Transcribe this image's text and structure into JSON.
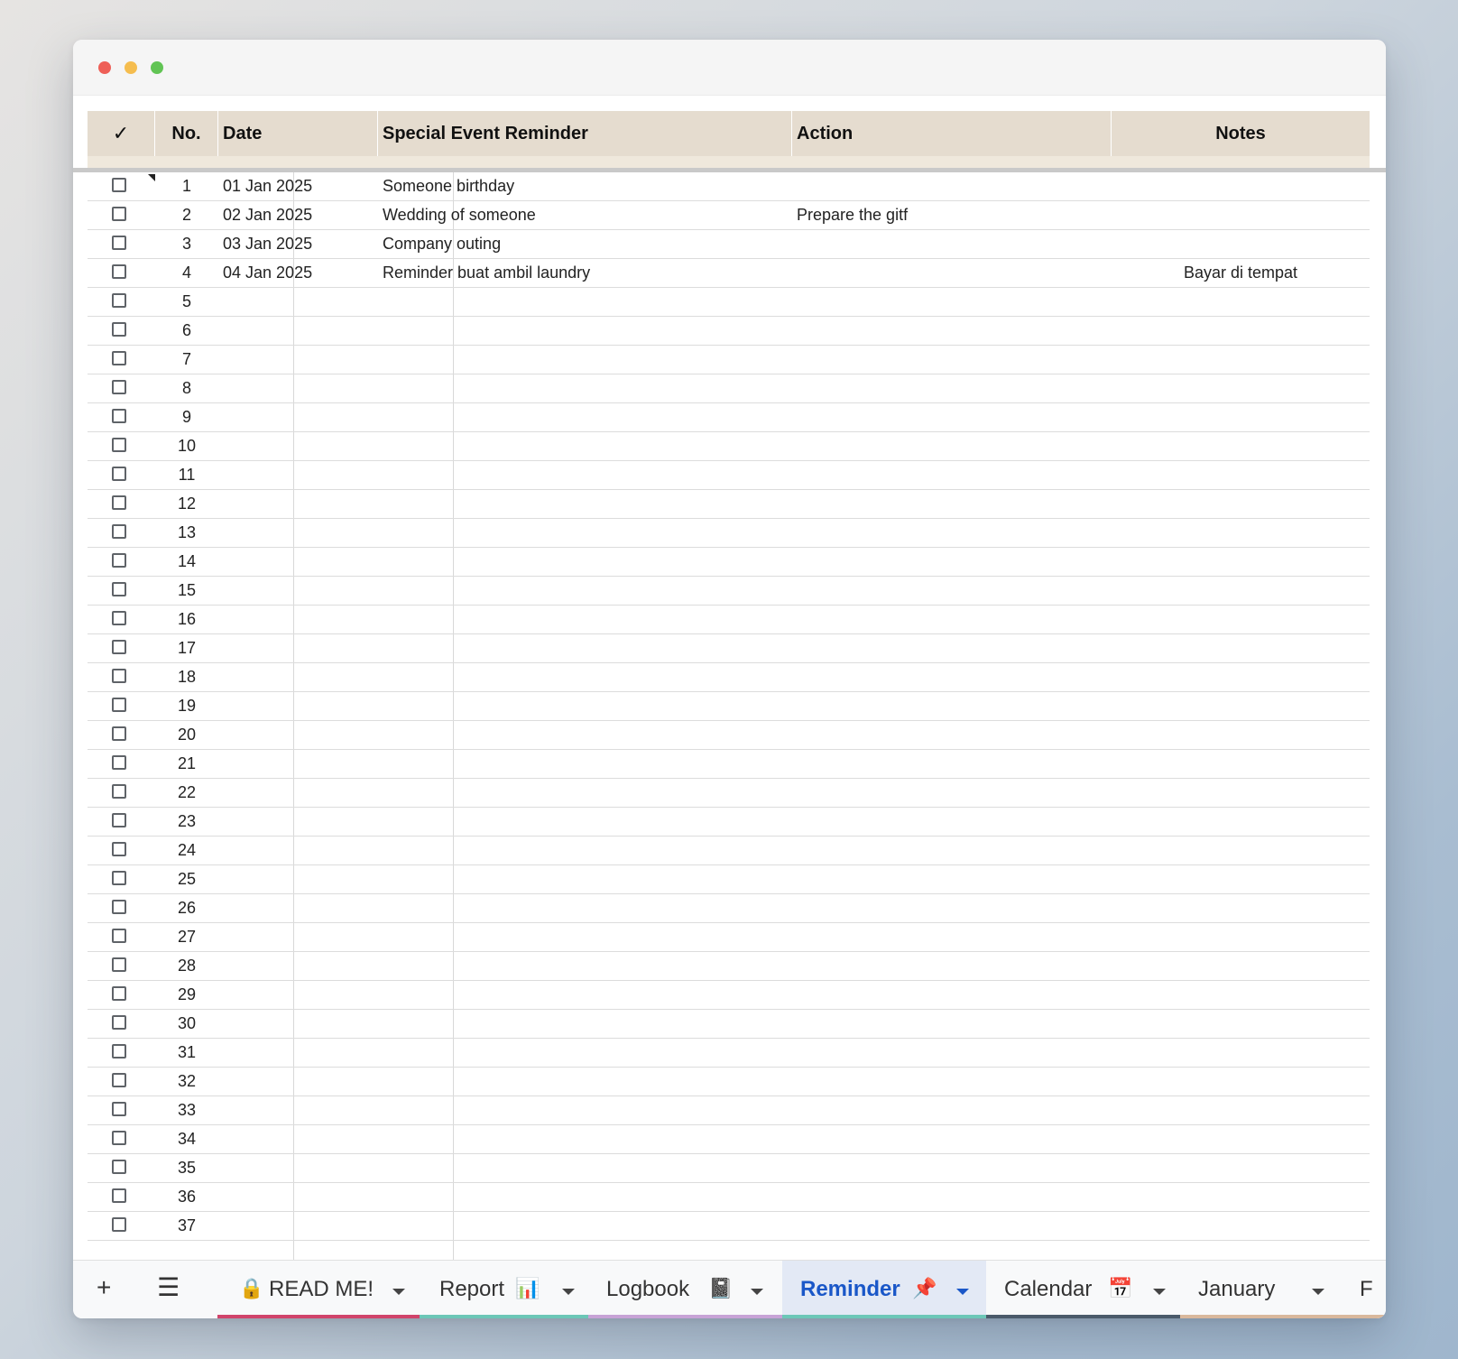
{
  "window": {
    "traffic_lights": [
      "close",
      "minimize",
      "zoom"
    ]
  },
  "sheet": {
    "headers": {
      "check": "✓",
      "no": "No.",
      "date": "Date",
      "event": "Special Event Reminder",
      "action": "Action",
      "notes": "Notes"
    },
    "rows": [
      {
        "no": "1",
        "date": "01 Jan 2025",
        "event": "Someone birthday",
        "action": "",
        "notes": "",
        "checked": false
      },
      {
        "no": "2",
        "date": "02 Jan 2025",
        "event": "Wedding of someone",
        "action": "Prepare the gitf",
        "notes": "",
        "checked": false
      },
      {
        "no": "3",
        "date": "03 Jan 2025",
        "event": "Company outing",
        "action": "",
        "notes": "",
        "checked": false
      },
      {
        "no": "4",
        "date": "04 Jan 2025",
        "event": "Reminder buat ambil laundry",
        "action": "",
        "notes": "Bayar di tempat",
        "checked": false
      },
      {
        "no": "5",
        "date": "",
        "event": "",
        "action": "",
        "notes": "",
        "checked": false
      },
      {
        "no": "6",
        "date": "",
        "event": "",
        "action": "",
        "notes": "",
        "checked": false
      },
      {
        "no": "7",
        "date": "",
        "event": "",
        "action": "",
        "notes": "",
        "checked": false
      },
      {
        "no": "8",
        "date": "",
        "event": "",
        "action": "",
        "notes": "",
        "checked": false
      },
      {
        "no": "9",
        "date": "",
        "event": "",
        "action": "",
        "notes": "",
        "checked": false
      },
      {
        "no": "10",
        "date": "",
        "event": "",
        "action": "",
        "notes": "",
        "checked": false
      },
      {
        "no": "11",
        "date": "",
        "event": "",
        "action": "",
        "notes": "",
        "checked": false
      },
      {
        "no": "12",
        "date": "",
        "event": "",
        "action": "",
        "notes": "",
        "checked": false
      },
      {
        "no": "13",
        "date": "",
        "event": "",
        "action": "",
        "notes": "",
        "checked": false
      },
      {
        "no": "14",
        "date": "",
        "event": "",
        "action": "",
        "notes": "",
        "checked": false
      },
      {
        "no": "15",
        "date": "",
        "event": "",
        "action": "",
        "notes": "",
        "checked": false
      },
      {
        "no": "16",
        "date": "",
        "event": "",
        "action": "",
        "notes": "",
        "checked": false
      },
      {
        "no": "17",
        "date": "",
        "event": "",
        "action": "",
        "notes": "",
        "checked": false
      },
      {
        "no": "18",
        "date": "",
        "event": "",
        "action": "",
        "notes": "",
        "checked": false
      },
      {
        "no": "19",
        "date": "",
        "event": "",
        "action": "",
        "notes": "",
        "checked": false
      },
      {
        "no": "20",
        "date": "",
        "event": "",
        "action": "",
        "notes": "",
        "checked": false
      },
      {
        "no": "21",
        "date": "",
        "event": "",
        "action": "",
        "notes": "",
        "checked": false
      },
      {
        "no": "22",
        "date": "",
        "event": "",
        "action": "",
        "notes": "",
        "checked": false
      },
      {
        "no": "23",
        "date": "",
        "event": "",
        "action": "",
        "notes": "",
        "checked": false
      },
      {
        "no": "24",
        "date": "",
        "event": "",
        "action": "",
        "notes": "",
        "checked": false
      },
      {
        "no": "25",
        "date": "",
        "event": "",
        "action": "",
        "notes": "",
        "checked": false
      },
      {
        "no": "26",
        "date": "",
        "event": "",
        "action": "",
        "notes": "",
        "checked": false
      },
      {
        "no": "27",
        "date": "",
        "event": "",
        "action": "",
        "notes": "",
        "checked": false
      },
      {
        "no": "28",
        "date": "",
        "event": "",
        "action": "",
        "notes": "",
        "checked": false
      },
      {
        "no": "29",
        "date": "",
        "event": "",
        "action": "",
        "notes": "",
        "checked": false
      },
      {
        "no": "30",
        "date": "",
        "event": "",
        "action": "",
        "notes": "",
        "checked": false
      },
      {
        "no": "31",
        "date": "",
        "event": "",
        "action": "",
        "notes": "",
        "checked": false
      },
      {
        "no": "32",
        "date": "",
        "event": "",
        "action": "",
        "notes": "",
        "checked": false
      },
      {
        "no": "33",
        "date": "",
        "event": "",
        "action": "",
        "notes": "",
        "checked": false
      },
      {
        "no": "34",
        "date": "",
        "event": "",
        "action": "",
        "notes": "",
        "checked": false
      },
      {
        "no": "35",
        "date": "",
        "event": "",
        "action": "",
        "notes": "",
        "checked": false
      },
      {
        "no": "36",
        "date": "",
        "event": "",
        "action": "",
        "notes": "",
        "checked": false
      },
      {
        "no": "37",
        "date": "",
        "event": "",
        "action": "",
        "notes": "",
        "checked": false
      }
    ]
  },
  "tabbar": {
    "add_icon": "plus-icon",
    "menu_icon": "hamburger-menu-icon",
    "tabs": [
      {
        "label": "READ ME!",
        "icon": "lock-icon",
        "icon_side": "left",
        "color": "#d0446b",
        "active": false
      },
      {
        "label": "Report",
        "icon": "bar-chart-icon",
        "icon_side": "right",
        "color": "#6cc7b7",
        "active": false
      },
      {
        "label": "Logbook",
        "icon": "notebook-icon",
        "icon_side": "right",
        "color": "#c7a3d6",
        "active": false
      },
      {
        "label": "Reminder",
        "icon": "pushpin-icon",
        "icon_side": "right",
        "color": "#6cc7b7",
        "active": true
      },
      {
        "label": "Calendar",
        "icon": "calendar-icon",
        "icon_side": "right",
        "color": "#4a5a6a",
        "active": false
      },
      {
        "label": "January",
        "icon": "",
        "icon_side": "",
        "color": "#d9b89c",
        "active": false
      },
      {
        "label": "F",
        "icon": "",
        "icon_side": "",
        "color": "#d9b89c",
        "active": false
      }
    ]
  }
}
